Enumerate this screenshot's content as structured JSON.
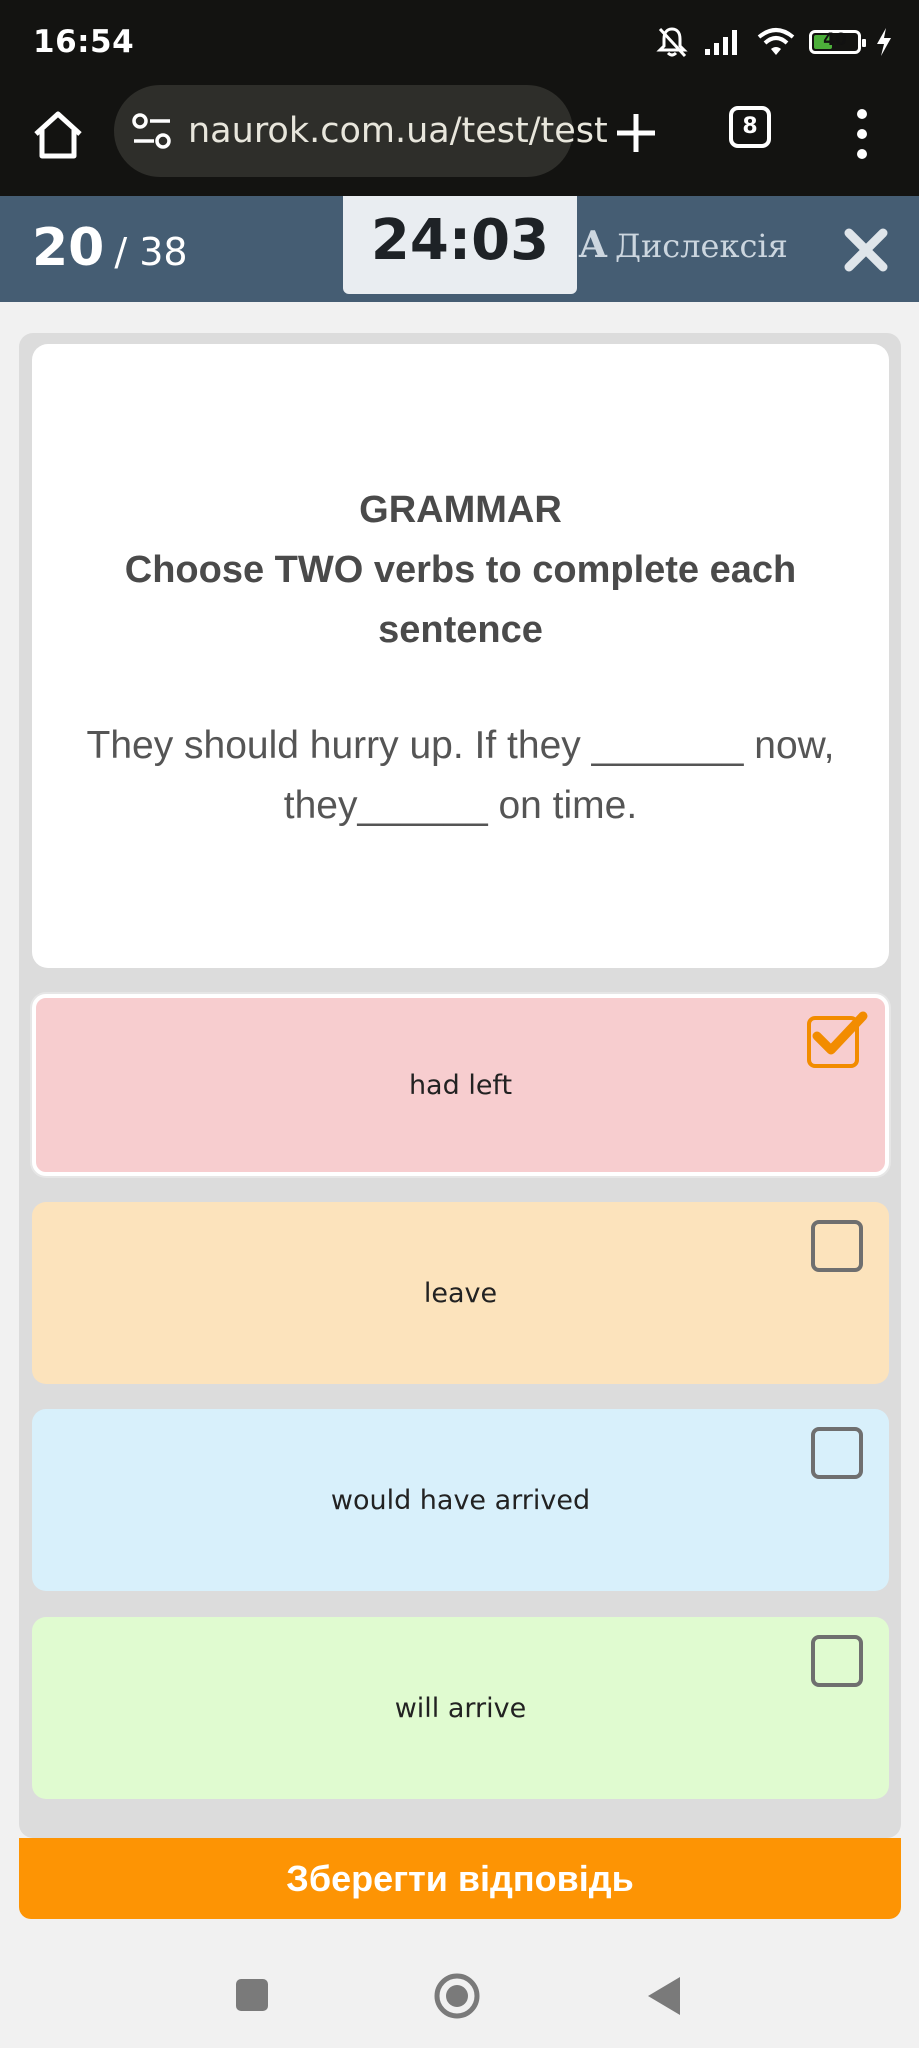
{
  "status_bar": {
    "time": "16:54",
    "battery": "40",
    "battery_level": 0.4
  },
  "browser": {
    "url": "naurok.com.ua/test/test",
    "tab_count": "8"
  },
  "quiz_header": {
    "current": "20",
    "total": "/ 38",
    "timer": "24:03",
    "dyslexia_icon_letter": "A",
    "dyslexia_label": "Дислексія"
  },
  "question": {
    "heading_line1": "GRAMMAR",
    "heading_line2": "Choose TWO verbs to complete each sentence",
    "sentence": "They should hurry up. If they _______ now, they______ on time."
  },
  "options": [
    {
      "label": "had left",
      "checked": true,
      "color": "#f7cdcf"
    },
    {
      "label": "leave",
      "checked": false,
      "color": "#fce3bc"
    },
    {
      "label": "would have arrived",
      "checked": false,
      "color": "#d8f0fb"
    },
    {
      "label": "will arrive",
      "checked": false,
      "color": "#e0fbd0"
    }
  ],
  "save_button": "Зберегти відповідь",
  "colors": {
    "accent_orange": "#fd9404",
    "header_blue": "#455d73",
    "checkbox_checked": "#f28c00"
  }
}
